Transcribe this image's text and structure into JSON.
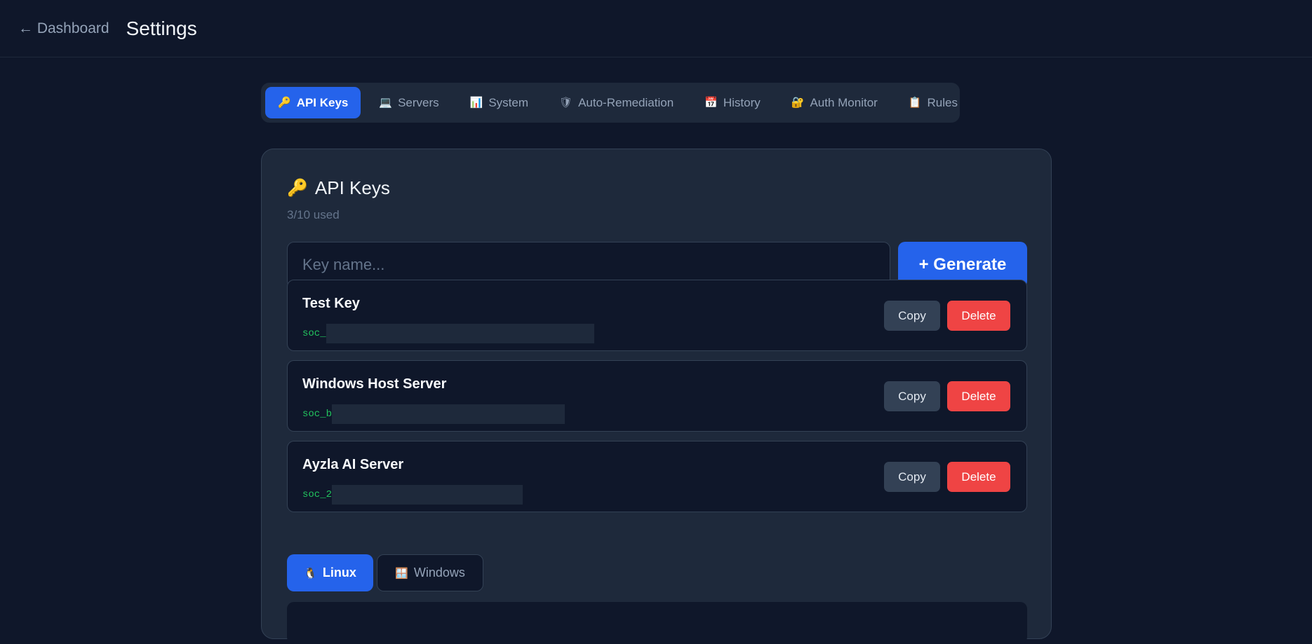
{
  "header": {
    "back_label": "← Dashboard",
    "title": "Settings"
  },
  "tabs": [
    {
      "label": "API Keys",
      "icon": "🔑",
      "icon_name": "key-icon",
      "active": true
    },
    {
      "label": "Servers",
      "icon": "💻",
      "icon_name": "computer-icon",
      "active": false
    },
    {
      "label": "System",
      "icon": "📊",
      "icon_name": "bar-chart-icon",
      "active": false
    },
    {
      "label": "Auto-Remediation",
      "icon": "🛡",
      "icon_name": "shield-icon",
      "active": false
    },
    {
      "label": "History",
      "icon": "📅",
      "icon_name": "calendar-icon",
      "active": false
    },
    {
      "label": "Auth Monitor",
      "icon": "🔐",
      "icon_name": "lock-icon",
      "active": false
    },
    {
      "label": "Rules",
      "icon": "📋",
      "icon_name": "clipboard-icon",
      "active": false
    }
  ],
  "panel": {
    "icon": "🔑",
    "title": "API Keys",
    "usage": "3/10 used",
    "input_placeholder": "Key name...",
    "generate_label": "+ Generate"
  },
  "keys": [
    {
      "name": "Test Key",
      "prefix": "soc_",
      "copy_label": "Copy",
      "delete_label": "Delete"
    },
    {
      "name": "Windows Host Server",
      "prefix": "soc_b",
      "copy_label": "Copy",
      "delete_label": "Delete"
    },
    {
      "name": "Ayzla AI Server",
      "prefix": "soc_2",
      "copy_label": "Copy",
      "delete_label": "Delete"
    }
  ],
  "os_tabs": [
    {
      "label": "Linux",
      "icon": "🐧",
      "icon_name": "penguin-icon",
      "active": true
    },
    {
      "label": "Windows",
      "icon": "🪟",
      "icon_name": "windows-icon",
      "active": false
    }
  ],
  "colors": {
    "background": "#0f172a",
    "panel": "#1e293b",
    "accent": "#2563eb",
    "danger": "#ef4444",
    "key_text": "#22c55e"
  }
}
